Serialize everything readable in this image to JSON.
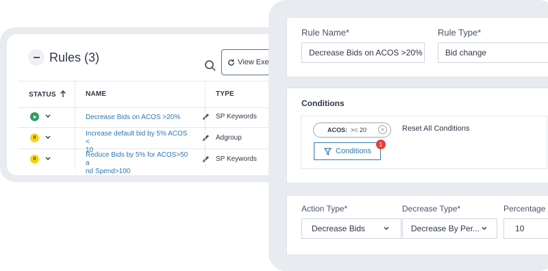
{
  "rules_panel": {
    "title": "Rules (3)",
    "view_executions_label": "View Executio",
    "columns": {
      "status": "STATUS",
      "name": "NAME",
      "type": "TYPE"
    },
    "rows": [
      {
        "status": "active",
        "status_glyph": "",
        "name_line1": "Decrease Bids on ACOS >20%",
        "name_line2": "",
        "type": "SP Keywords"
      },
      {
        "status": "paused",
        "status_glyph": "II",
        "name_line1": "Increase default bid by 5% ACOS <",
        "name_line2": "10",
        "type": "Adgroup"
      },
      {
        "status": "paused",
        "status_glyph": "II",
        "name_line1": "Reduce Bids by 5% for ACOS>50 a",
        "name_line2": "nd Spend>100",
        "type": "SP Keywords"
      }
    ]
  },
  "rule_editor": {
    "rule_name_label": "Rule Name*",
    "rule_name_value": "Decrease Bids on ACOS >20%",
    "rule_type_label": "Rule Type*",
    "rule_type_value": "Bid change",
    "conditions_title": "Conditions",
    "condition_chip": {
      "key": "ACOS:",
      "value": ">= 20"
    },
    "reset_label": "Reset All Conditions",
    "conditions_button": "Conditions",
    "conditions_count": "1",
    "action_type_label": "Action Type*",
    "action_type_value": "Decrease Bids",
    "decrease_type_label": "Decrease Type*",
    "decrease_type_value": "Decrease By Per...",
    "percentage_label": "Percentage",
    "percentage_value": "10"
  },
  "colors": {
    "link": "#2f76b0",
    "active_status": "#2f9e62",
    "paused_status": "#f6d21f",
    "badge": "#e53e3e"
  }
}
